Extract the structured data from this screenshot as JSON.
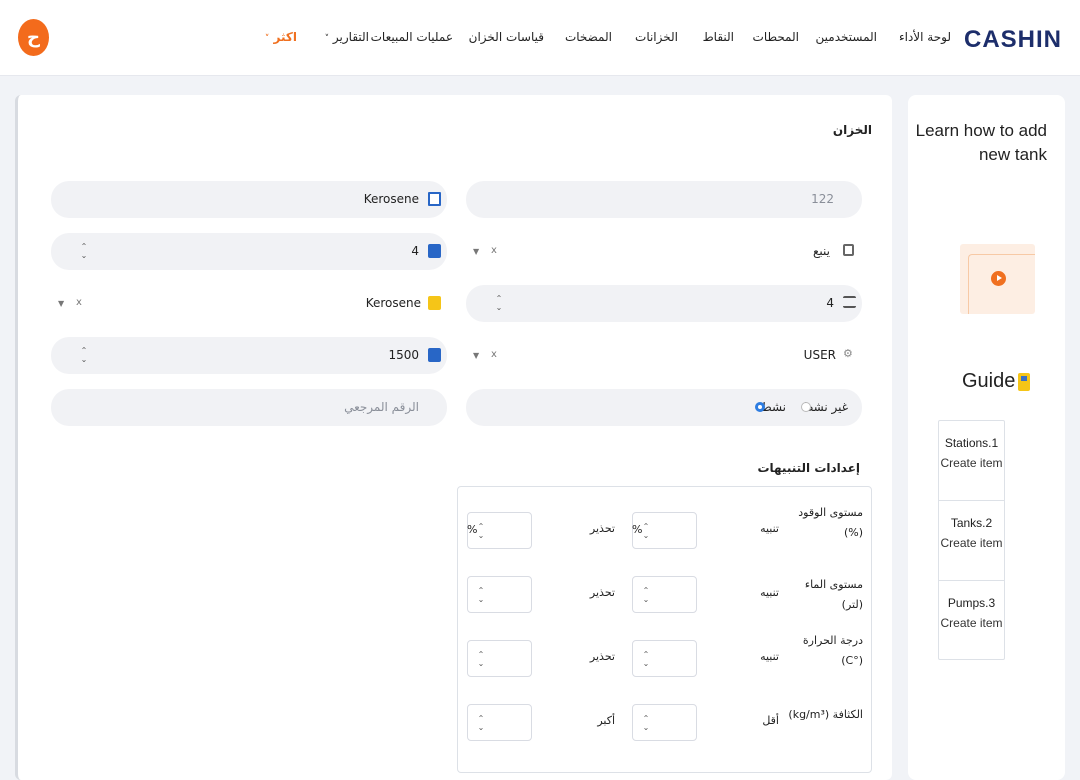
{
  "app": {
    "brand": "CASHIN",
    "avatar_letter": "ح"
  },
  "nav": [
    {
      "label": "لوحة الأداء"
    },
    {
      "label": "المستخدمين"
    },
    {
      "label": "المحطات"
    },
    {
      "label": "النقاط"
    },
    {
      "label": "الخزانات"
    },
    {
      "label": "المضخات"
    },
    {
      "label": "قياسات الخزان"
    },
    {
      "label": "عمليات المبيعات"
    },
    {
      "label": "التقارير"
    },
    {
      "label": "اكثر"
    }
  ],
  "sidebar": {
    "title": "Learn how to add new tank",
    "guide_label": "Guide",
    "steps": [
      {
        "title": "Stations.1",
        "action": "Create item"
      },
      {
        "title": "Tanks.2",
        "action": "Create item"
      },
      {
        "title": "Pumps.3",
        "action": "Create item"
      }
    ]
  },
  "form": {
    "section_title": "الخزان",
    "tank_number": "122",
    "fuel_name": "Kerosene",
    "station": "ينبع",
    "tank_count": "4",
    "points": "4",
    "fuel_type": "Kerosene",
    "user": "USER",
    "capacity": "1500",
    "status_active": "نشط",
    "status_inactive": "غير نشط",
    "reference_placeholder": "الرقم المرجعي"
  },
  "alerts": {
    "title": "إعدادات التنبيهات",
    "rows": [
      {
        "label": "مستوى الوقود (%)",
        "left": "تنبيه",
        "right": "تحذير",
        "unit": "%"
      },
      {
        "label": "مستوى الماء (لتر)",
        "left": "تنبيه",
        "right": "تحذير",
        "unit": ""
      },
      {
        "label": "درجة الحرارة (°C)",
        "left": "تنبيه",
        "right": "تحذير",
        "unit": ""
      },
      {
        "label": "الكثافة (kg/m³)",
        "left": "أقل",
        "right": "أكبر",
        "unit": ""
      }
    ]
  }
}
